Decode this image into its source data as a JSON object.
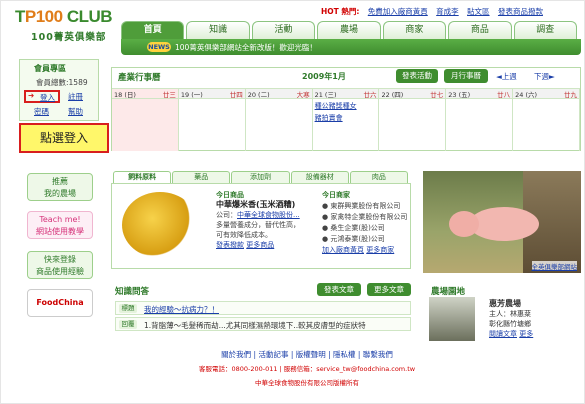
{
  "logo": {
    "main_prefix": "T",
    "main_nums": "P100",
    "main_suffix": " CLUB",
    "sub": "100菁英俱樂部"
  },
  "top_links": {
    "hot": "HOT 熱門:",
    "items": [
      "免費加入廠商黃頁",
      "育成李",
      "貼文區",
      "發表商品撥款"
    ]
  },
  "nav_tabs": [
    "首頁",
    "知識",
    "活動",
    "農場",
    "商家",
    "商品",
    "調查"
  ],
  "news": {
    "badge": "NEWS",
    "text": "100菁英俱樂部網站全新改版！歡迎光臨！"
  },
  "member": {
    "title": "會員專區",
    "count_label": "會員總數:1589",
    "login": "登入",
    "register": "註冊",
    "forgot": "密碼",
    "help": "幫助"
  },
  "callout": "點選登入",
  "side_banners": [
    {
      "line1": "推薦",
      "line2": "我的農場"
    },
    {
      "line1": "Teach me!",
      "line2": "網站使用教學"
    },
    {
      "line1": "快來登錄",
      "line2": "商品使用經驗"
    },
    {
      "line1": "FoodChina",
      "line2": ""
    }
  ],
  "calendar": {
    "title": "產業行事曆",
    "month": "2009年1月",
    "btn_activity": "發表活動",
    "btn_month": "月行事曆",
    "prev": "◄上週",
    "next": "下週►",
    "days": [
      {
        "d": "18 (日)",
        "lunar": "廿三"
      },
      {
        "d": "19 (一)",
        "lunar": "廿四"
      },
      {
        "d": "20 (二)",
        "lunar": "大寒"
      },
      {
        "d": "21 (三)",
        "lunar": "廿六"
      },
      {
        "d": "22 (四)",
        "lunar": "廿七"
      },
      {
        "d": "23 (五)",
        "lunar": "廿八"
      },
      {
        "d": "24 (六)",
        "lunar": "廿九"
      }
    ],
    "events": [
      "種公豬獎種女",
      "豬拍賣會"
    ]
  },
  "products": {
    "tabs": [
      "飼料原料",
      "藥品",
      "添加劑",
      "設備器材",
      "肉品"
    ],
    "today_label": "今日商品",
    "name": "中華爆米香(玉米酒糟)",
    "company_label": "公司：",
    "company": "中華全球食物股份...",
    "desc1": "多量營養成分，替代性高，",
    "desc2": "可有效降低成本。",
    "link_post": "發表撥款",
    "link_more": "更多商品",
    "vendor_label": "今日商家",
    "vendors": [
      "東群興業股份有限公司",
      "家禽特企業股份有限公司",
      "桑生企業(股)公司",
      "元鴻泰業(股)公司"
    ],
    "vendor_join": "加入廠商黃頁",
    "vendor_more": "更多商家"
  },
  "pig_photo_link": "全英俱樂部網站",
  "qa": {
    "title": "知識問答",
    "btn_post": "發表文章",
    "btn_more": "更多文章",
    "q_tag": "標題",
    "q_text": "我的經驗～抗病力？！",
    "a_tag": "回覆",
    "a_text": "1.背脂薄～毛髮稀而劫...尤其同樣濕熱環境下..較其皮膚型的症狀特"
  },
  "farm": {
    "title": "農場園地",
    "name": "惠芳農場",
    "owner": "主人：林惠棻",
    "location": "彰化縣竹塘鄉",
    "link_read": "閱讀文章",
    "link_more": "更多"
  },
  "footer": {
    "links": "關於我們 | 活動記事 | 版權聲明 | 隱私權 | 聯繫我們",
    "contact": "客服電話：0800-200-011 | 服務信箱：service_tw@foodchina.com.tw",
    "copy": "中華全球食物股份有限公司版權所有"
  }
}
